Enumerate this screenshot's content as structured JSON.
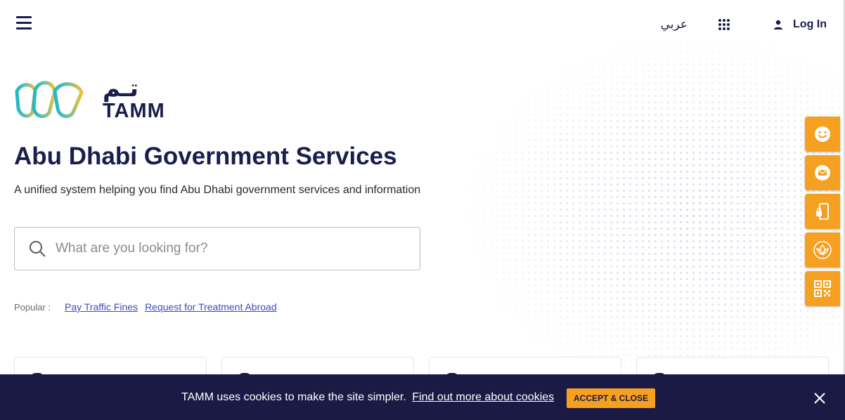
{
  "header": {
    "language_label": "عربي",
    "login_label": "Log In"
  },
  "logo": {
    "arabic": "تـم",
    "english": "TAMM"
  },
  "hero": {
    "title": "Abu Dhabi Government Services",
    "subtitle": "A unified system helping you find Abu Dhabi government services and information"
  },
  "search": {
    "placeholder": "What are you looking for?",
    "value": ""
  },
  "popular": {
    "label": "Popular :",
    "links": [
      "Pay Traffic Fines",
      "Request for Treatment Abroad"
    ]
  },
  "side_actions": [
    "smiley-icon",
    "envelope-icon",
    "phone-lock-icon",
    "lotus-icon",
    "qr-code-icon"
  ],
  "cookie_banner": {
    "text": "TAMM uses cookies to make the site simpler.",
    "link": "Find out more about cookies",
    "accept_label": "ACCEPT & CLOSE"
  },
  "colors": {
    "navy": "#1b1d4d",
    "accent_orange": "#f5a020",
    "link_blue": "#3b4cc0",
    "banner_bg": "#1b1a45"
  }
}
